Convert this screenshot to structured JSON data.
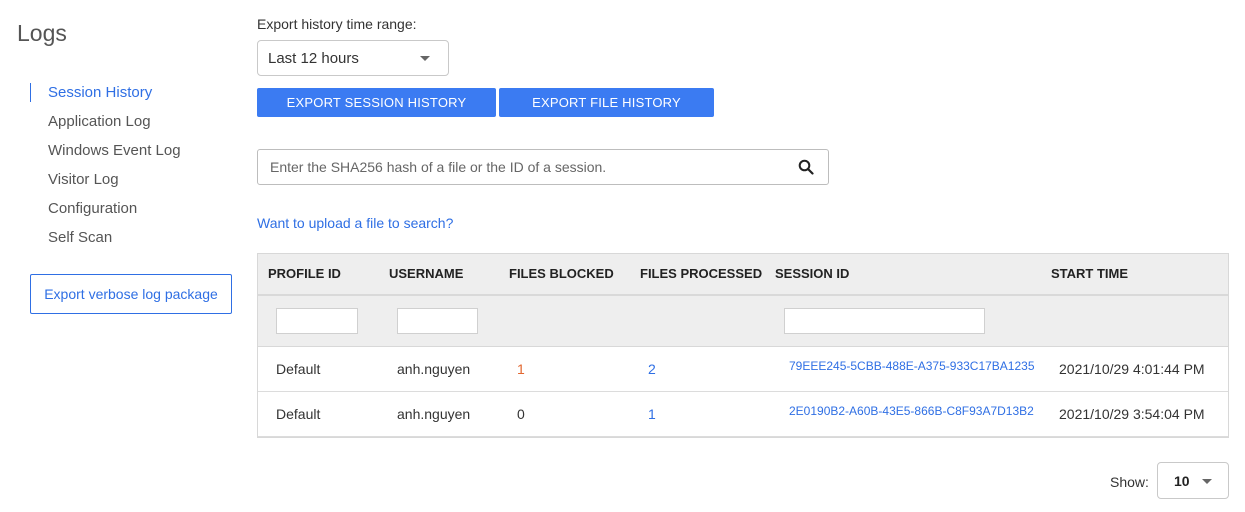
{
  "sidebar": {
    "title": "Logs",
    "items": [
      {
        "label": "Session History",
        "active": true
      },
      {
        "label": "Application Log"
      },
      {
        "label": "Windows Event Log"
      },
      {
        "label": "Visitor Log"
      },
      {
        "label": "Configuration"
      },
      {
        "label": "Self Scan"
      }
    ],
    "verbose_button": "Export verbose log package"
  },
  "export": {
    "range_label": "Export history time range:",
    "range_value": "Last 12 hours",
    "session_button": "EXPORT SESSION HISTORY",
    "file_button": "EXPORT FILE HISTORY"
  },
  "search": {
    "placeholder": "Enter the SHA256 hash of a file or the ID of a session.",
    "icon": "search-icon"
  },
  "upload_link": "Want to upload a file to search?",
  "table": {
    "headers": [
      "PROFILE ID",
      "USERNAME",
      "FILES BLOCKED",
      "FILES PROCESSED",
      "SESSION ID",
      "START TIME"
    ],
    "rows": [
      {
        "profile": "Default",
        "username": "anh.nguyen",
        "blocked": "1",
        "processed": "2",
        "session_id": "79EEE245-5CBB-488E-A375-933C17BA1235",
        "date": "2021/10/29",
        "time": "4:01:44 PM"
      },
      {
        "profile": "Default",
        "username": "anh.nguyen",
        "blocked": "0",
        "processed": "1",
        "session_id": "2E0190B2-A60B-43E5-866B-C8F93A7D13B2",
        "date": "2021/10/29",
        "time": "3:54:04 PM"
      }
    ]
  },
  "pagination": {
    "show_label": "Show:",
    "show_value": "10"
  },
  "colors": {
    "accent": "#3b7bf2",
    "link": "#2f6fe4",
    "blocked": "#e2662f"
  }
}
